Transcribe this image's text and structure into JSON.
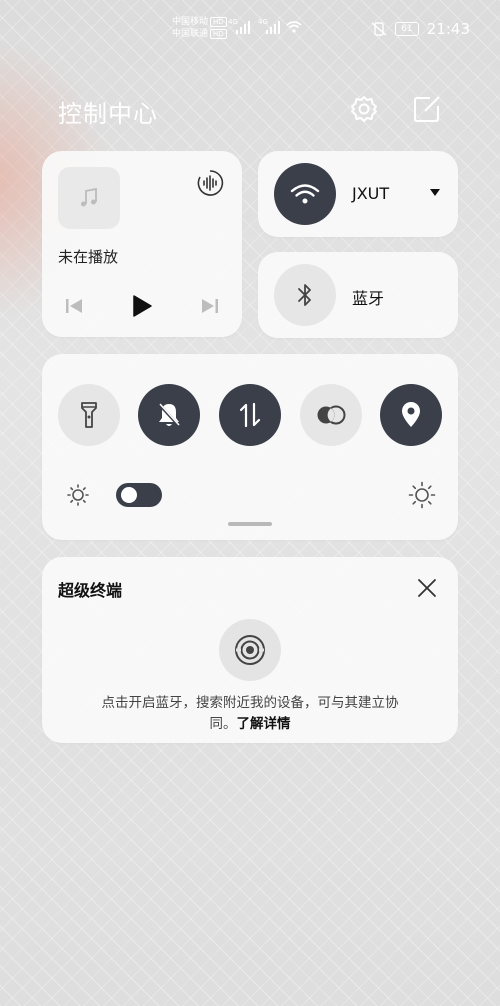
{
  "status_bar": {
    "carrier_1": "中国移动",
    "carrier_2": "中国联通",
    "hd_badge": "HD",
    "network_1": "4G",
    "network_2": "4G",
    "battery": "61",
    "time": "21:43",
    "icons": [
      "signal-icon",
      "wifi-icon",
      "vibrate-icon",
      "battery-icon"
    ]
  },
  "header": {
    "title": "控制中心",
    "icons": [
      "settings-icon",
      "edit-icon"
    ]
  },
  "music": {
    "title": "未在播放",
    "icons": [
      "music-note-icon",
      "audio-output-icon",
      "previous-icon",
      "play-icon",
      "next-icon"
    ]
  },
  "wifi": {
    "label": "JXUT",
    "icon": "wifi-icon",
    "state": "on"
  },
  "bluetooth": {
    "label": "蓝牙",
    "icon": "bluetooth-icon",
    "state": "off"
  },
  "toggles": [
    {
      "name": "flashlight",
      "icon": "flashlight-icon",
      "state": "off"
    },
    {
      "name": "silent",
      "icon": "bell-off-icon",
      "state": "on"
    },
    {
      "name": "mobile-data",
      "icon": "mobile-data-icon",
      "state": "on"
    },
    {
      "name": "eye-comfort",
      "icon": "eye-comfort-icon",
      "state": "off"
    },
    {
      "name": "location",
      "icon": "location-icon",
      "state": "on"
    }
  ],
  "brightness": {
    "auto": "on",
    "icons": [
      "sun-low-icon",
      "sun-high-icon"
    ]
  },
  "super_device": {
    "title": "超级终端",
    "desc_line1": "点击开启蓝牙，搜索附近我的设备，可与其建立协",
    "desc_line2": "同。",
    "link": "了解详情",
    "icons": [
      "close-icon",
      "super-device-icon"
    ]
  },
  "colors": {
    "active": "#3b3f4a",
    "inactive": "#e6e6e6",
    "card": "#fafafa"
  }
}
